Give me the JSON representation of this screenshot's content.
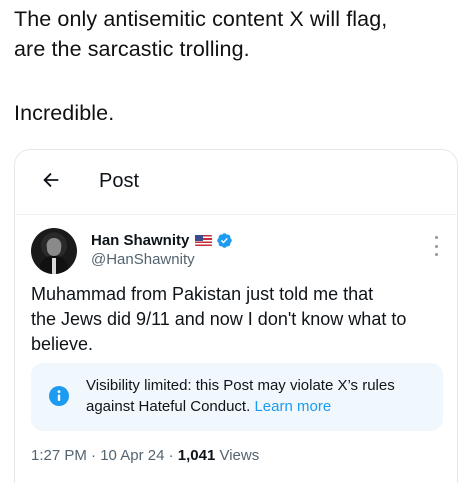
{
  "caption": {
    "line1": "The only antisemitic content X will flag,",
    "line2": "are the sarcastic trolling.",
    "line3": "Incredible."
  },
  "header": {
    "back_icon": "arrow-left-icon",
    "title": "Post"
  },
  "author": {
    "name": "Han Shawnity",
    "flag_icon": "us-flag-emoji",
    "verified_icon": "verified-badge-icon",
    "verified_color": "#1d9bf0",
    "handle": "@HanShawnity"
  },
  "post": {
    "line1": "Muhammad from Pakistan just told me that",
    "line2": "the Jews did 9/11 and now I don't know what to",
    "line3": "believe."
  },
  "notice": {
    "icon": "info-icon",
    "icon_color": "#1d9bf0",
    "background": "#f0f8fd",
    "line1": "Visibility limited: this Post may violate X’s rules",
    "line2": "against Hateful Conduct.",
    "learn_more": "Learn more"
  },
  "meta": {
    "time": "1:27 PM",
    "sep1": " · ",
    "date": "10 Apr 24",
    "sep2": " · ",
    "views_count": "1,041",
    "views_label": " Views"
  },
  "more_icon": "more-vertical-icon"
}
